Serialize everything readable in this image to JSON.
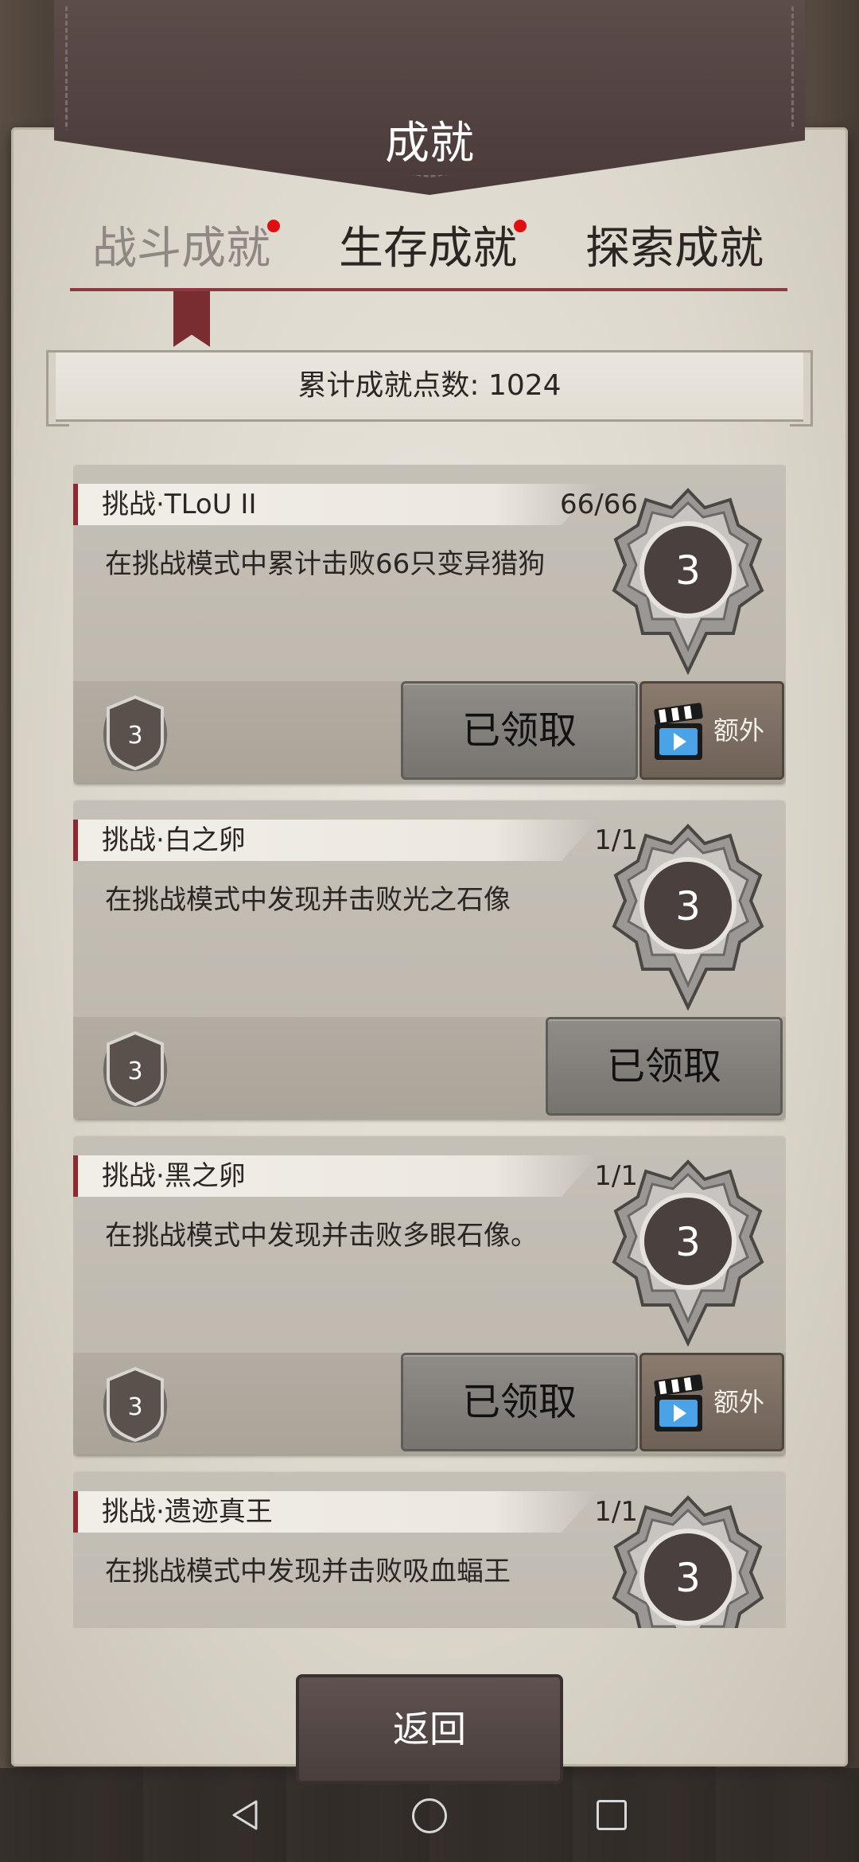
{
  "header": {
    "title": "成就"
  },
  "tabs": [
    {
      "label": "战斗成就",
      "active": true,
      "has_dot": true
    },
    {
      "label": "生存成就",
      "active": false,
      "has_dot": true
    },
    {
      "label": "探索成就",
      "active": false,
      "has_dot": false
    }
  ],
  "points": {
    "text": "累计成就点数: 1024"
  },
  "achievements": [
    {
      "name": "挑战·TLoU II",
      "progress": "66/66",
      "description": "在挑战模式中累计击败66只变异猎狗",
      "medal_value": "3",
      "reward_value": "3",
      "claim_label": "已领取",
      "extra_label": "额外",
      "has_extra": true
    },
    {
      "name": "挑战·白之卵",
      "progress": "1/1",
      "description": "在挑战模式中发现并击败光之石像",
      "medal_value": "3",
      "reward_value": "3",
      "claim_label": "已领取",
      "has_extra": false
    },
    {
      "name": "挑战·黑之卵",
      "progress": "1/1",
      "description": "在挑战模式中发现并击败多眼石像。",
      "medal_value": "3",
      "reward_value": "3",
      "claim_label": "已领取",
      "extra_label": "额外",
      "has_extra": true
    },
    {
      "name": "挑战·遗迹真王",
      "progress": "1/1",
      "description": "在挑战模式中发现并击败吸血蝠王",
      "medal_value": "3",
      "reward_value": "3"
    }
  ],
  "back_button": {
    "label": "返回"
  },
  "colors": {
    "accent_red": "#8c2a30",
    "notify_dot": "#e01010",
    "leather": "#4a3b3a",
    "parchment": "#e2ded4"
  }
}
